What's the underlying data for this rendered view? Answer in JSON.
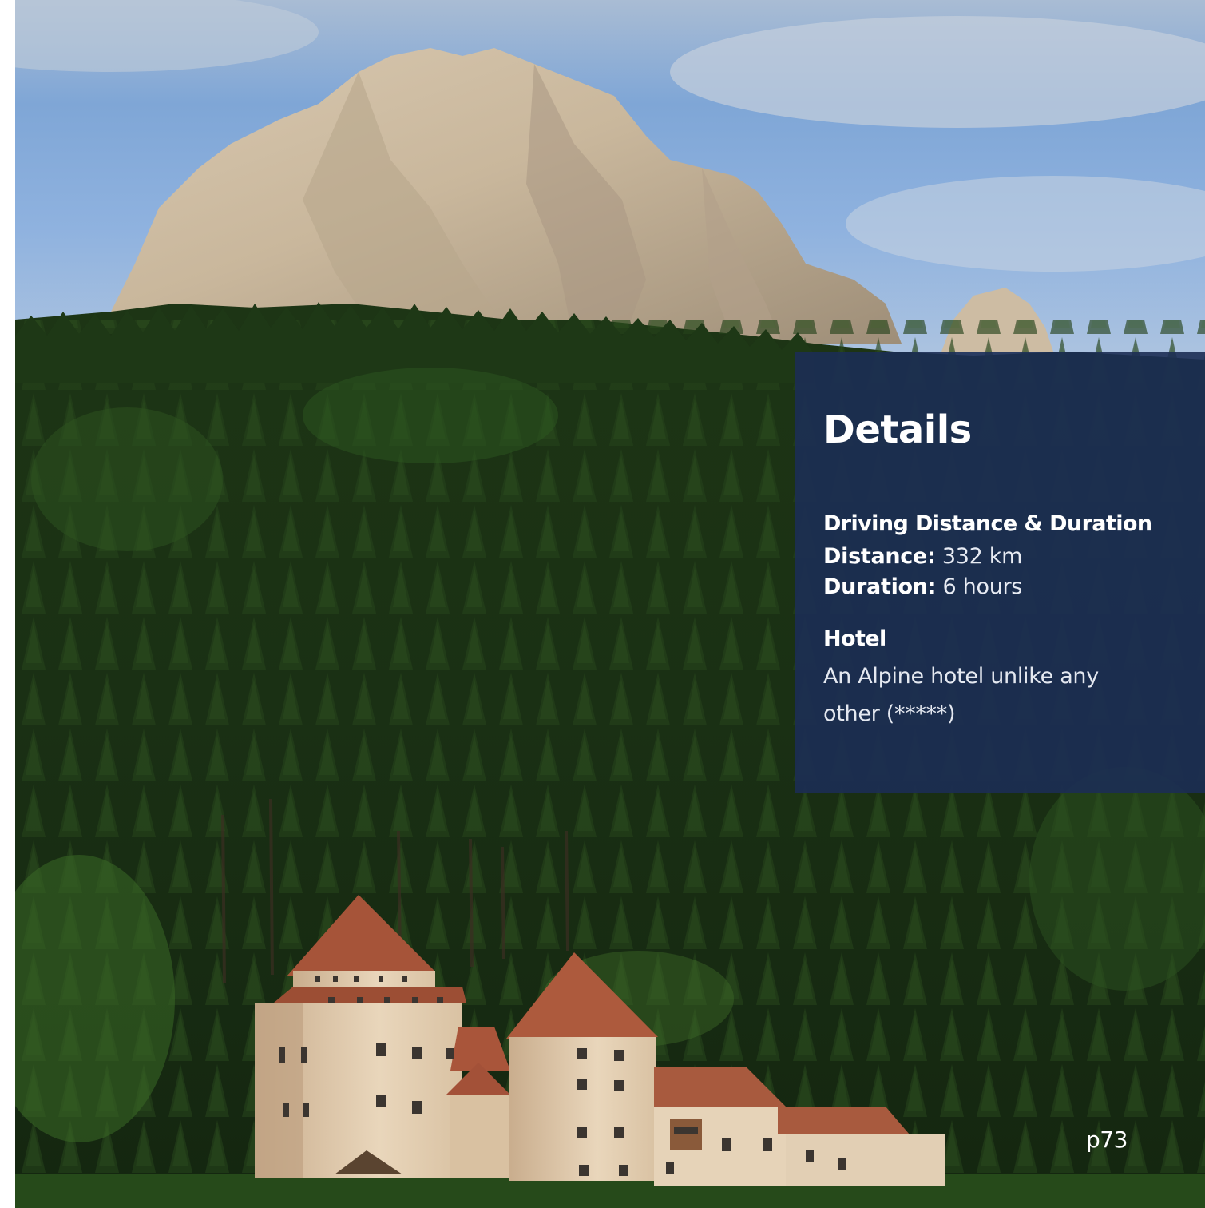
{
  "details": {
    "title": "Details",
    "driving_heading": "Driving Distance & Duration",
    "distance_label": "Distance:",
    "distance_value": "332 km",
    "duration_label": "Duration:",
    "duration_value": "6 hours",
    "hotel_heading": "Hotel",
    "hotel_description": "An Alpine hotel unlike any other (*****)"
  },
  "page_number": "p73",
  "colors": {
    "panel_background": "#1c2d54",
    "text": "#ffffff"
  }
}
